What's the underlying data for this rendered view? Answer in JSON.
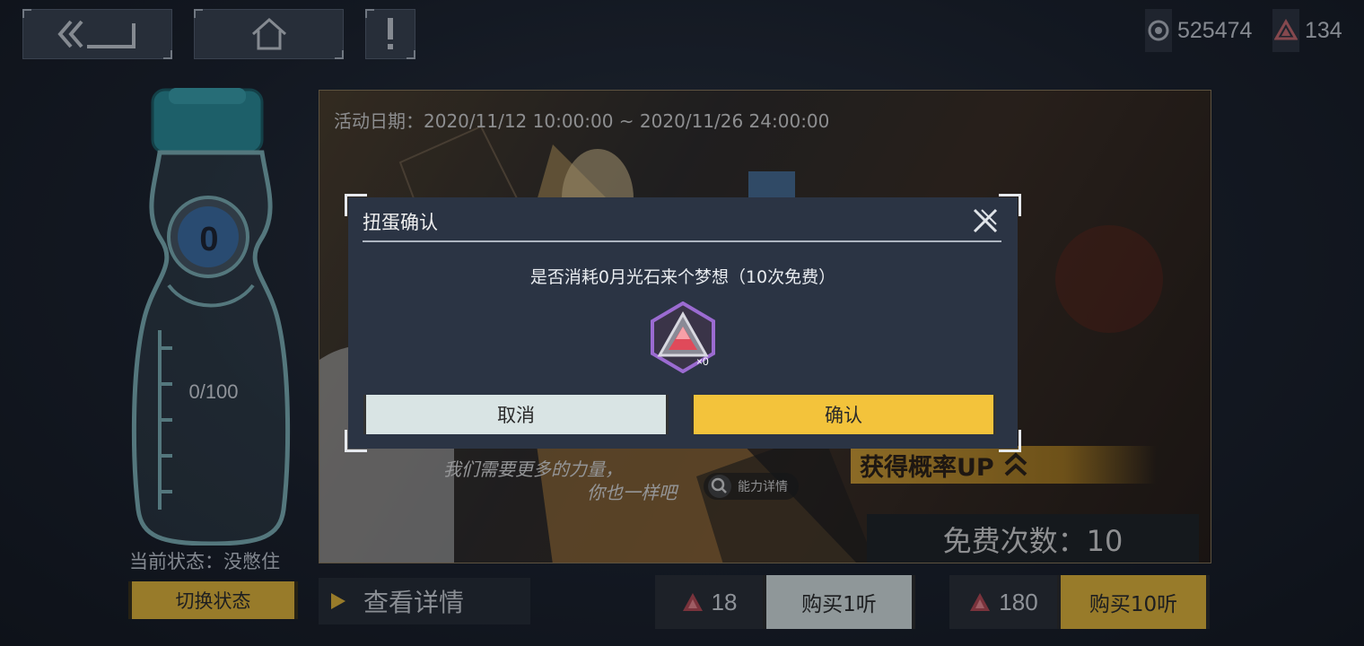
{
  "nav": {
    "back_icon": "double-chevron-back-icon",
    "home_icon": "home-icon",
    "alert_icon": "exclamation-icon"
  },
  "currency": {
    "light_amount": "525474",
    "stone_amount": "134"
  },
  "bottle": {
    "count": "0",
    "progress": "0/100",
    "progress_value": 0,
    "state_label": "当前状态：没憋住",
    "switch_label": "切换状态"
  },
  "banner": {
    "date": "活动日期：2020/11/12 10:00:00 ~ 2020/11/26 24:00:00",
    "quote_line1": "我们需要更多的力量，",
    "quote_line2": "你也一样吧",
    "ability_label": "能力详情",
    "prob_up": "获得概率UP",
    "free_count": "免费次数：10"
  },
  "bottom": {
    "detail_label": "查看详情",
    "price_single": "18",
    "buy_single": "购买1听",
    "price_ten": "180",
    "buy_ten": "购买10听"
  },
  "dialog": {
    "title": "扭蛋确认",
    "message": "是否消耗0月光石来个梦想（10次免费）",
    "gem_count": "×0",
    "cancel": "取消",
    "confirm": "确认"
  },
  "colors": {
    "accent_yellow": "#f3c33b",
    "cancel_bg": "#d9e4e4",
    "dialog_bg": "#2b3444",
    "bottle_teal": "#2a8e9a",
    "gem_red": "#e04a5a"
  }
}
